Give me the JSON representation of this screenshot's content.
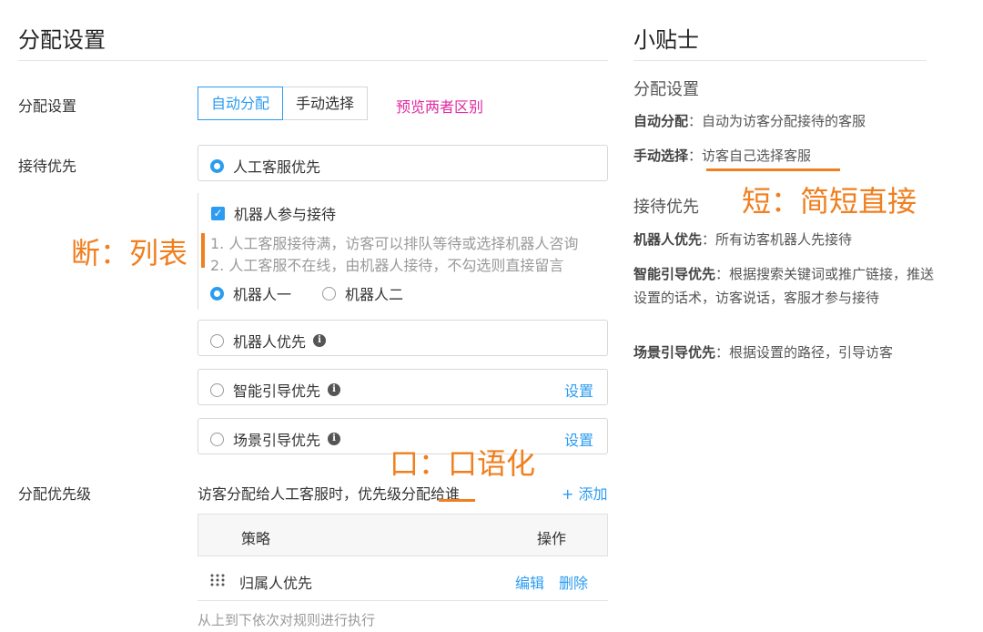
{
  "left": {
    "title": "分配设置",
    "assign_label": "分配设置",
    "seg": {
      "auto": "自动分配",
      "manual": "手动选择"
    },
    "preview_link": "预览两者区别",
    "reception_label": "接待优先",
    "human_first": "人工客服优先",
    "robot_join": "机器人参与接待",
    "note1": "1. 人工客服接待满，访客可以排队等待或选择机器人咨询",
    "note2": "2. 人工客服不在线，由机器人接待，不勾选则直接留言",
    "robot_one": "机器人一",
    "robot_two": "机器人二",
    "robot_first": "机器人优先",
    "smart_first": "智能引导优先",
    "scene_first": "场景引导优先",
    "setting_link": "设置",
    "priority_label": "分配优先级",
    "priority_desc": "访客分配给人工客服时，优先级分配给谁",
    "add_link": "+ 添加",
    "table": {
      "col_strategy": "策略",
      "col_action": "操作"
    },
    "rows": [
      {
        "name": "归属人优先",
        "edit": "编辑",
        "delete": "删除"
      }
    ],
    "footer_note": "从上到下依次对规则进行执行"
  },
  "annotations": {
    "duan": "断：列表",
    "kou": "口：口语化",
    "duan_short": "短：简短直接"
  },
  "tips": {
    "title": "小贴士",
    "h1": "分配设置",
    "auto_key": "自动分配",
    "auto_val": "：自动为访客分配接待的客服",
    "manual_key": "手动选择",
    "manual_val": "：访客自己选择客服",
    "h2": "接待优先",
    "robot_key": "机器人优先",
    "robot_val": "：所有访客机器人先接待",
    "smart_key": "智能引导优先",
    "smart_val": "：根据搜索关键词或推广链接，推送设置的话术，访客说话，客服才参与接待",
    "scene_key": "场景引导优先",
    "scene_val": "：根据设置的路径，引导访客"
  },
  "colors": {
    "accent": "#2c9cf0",
    "annotation": "#f07f1f",
    "preview": "#e02aa0"
  },
  "icons": {
    "info": "info-icon",
    "drag": "drag-handle-icon"
  }
}
